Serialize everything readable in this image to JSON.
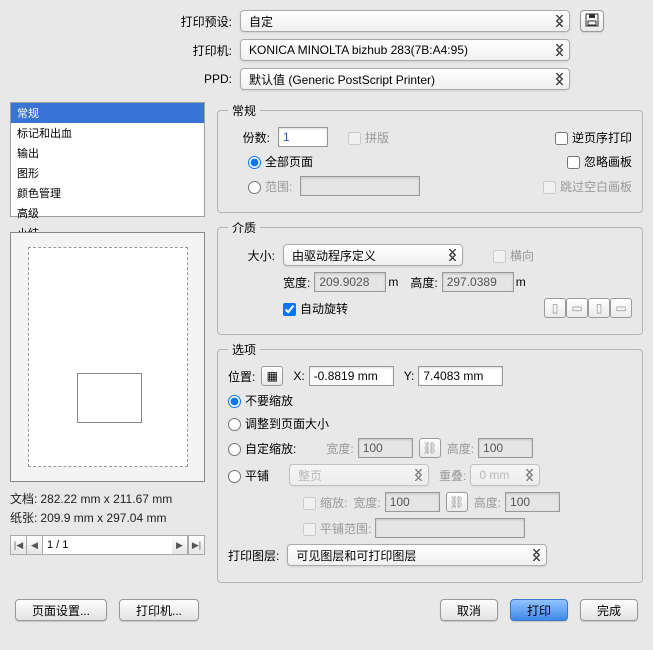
{
  "top": {
    "preset_label": "打印预设:",
    "preset_value": "自定",
    "printer_label": "打印机:",
    "printer_value": "KONICA MINOLTA bizhub 283(7B:A4:95)",
    "ppd_label": "PPD:",
    "ppd_value": "默认值 (Generic PostScript Printer)"
  },
  "sidebar": {
    "items": [
      "常规",
      "标记和出血",
      "输出",
      "图形",
      "颜色管理",
      "高级",
      "小结"
    ]
  },
  "preview": {
    "doc_label": "文档:",
    "doc_value": "282.22 mm x 211.67 mm",
    "paper_label": "纸张:",
    "paper_value": "209.9 mm x 297.04 mm",
    "page": "1 / 1"
  },
  "general": {
    "legend": "常规",
    "copies_label": "份数:",
    "copies_value": "1",
    "collate": "拼版",
    "reverse": "逆页序打印",
    "all_pages": "全部页面",
    "ignore_artboards": "忽略画板",
    "range_label": "范围:",
    "range_value": "",
    "skip_blank": "跳过空白画板"
  },
  "media": {
    "legend": "介质",
    "size_label": "大小:",
    "size_value": "由驱动程序定义",
    "landscape": "横向",
    "width_label": "宽度:",
    "width_value": "209.9028",
    "width_unit": "m",
    "height_label": "高度:",
    "height_value": "297.0389",
    "height_unit": "m",
    "auto_rotate": "自动旋转"
  },
  "options": {
    "legend": "选项",
    "placement_label": "位置:",
    "x_label": "X:",
    "x_value": "-0.8819 mm",
    "y_label": "Y:",
    "y_value": "7.4083 mm",
    "no_scale": "不要缩放",
    "fit_page": "调整到页面大小",
    "custom_scale": "自定缩放:",
    "cs_w_label": "宽度:",
    "cs_w_value": "100",
    "cs_h_label": "高度:",
    "cs_h_value": "100",
    "tile": "平铺",
    "tile_mode": "整页",
    "overlap_label": "重叠:",
    "overlap_value": "0 mm",
    "tile_scale": "缩放:",
    "ts_w_label": "宽度:",
    "ts_w_value": "100",
    "ts_h_label": "高度:",
    "ts_h_value": "100",
    "tile_range": "平铺范围:",
    "tile_range_value": "",
    "layers_label": "打印图层:",
    "layers_value": "可见图层和可打印图层"
  },
  "buttons": {
    "page_setup": "页面设置...",
    "printer": "打印机...",
    "cancel": "取消",
    "print": "打印",
    "done": "完成"
  }
}
